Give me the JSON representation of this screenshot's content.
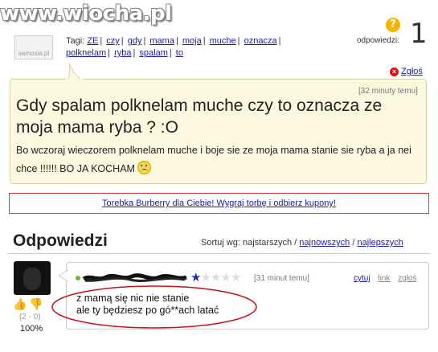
{
  "watermark": "www.wiocha.pl",
  "site_avatar_label": "samosia.pl",
  "tags": {
    "label": "Tagi:",
    "items": [
      "ZE",
      "czy",
      "gdy",
      "mama",
      "moja",
      "muche",
      "oznacza",
      "polknelam",
      "ryba",
      "spalam",
      "to"
    ]
  },
  "answers_label": "odpowiedzi:",
  "answers_count": "1",
  "report_label": "Zgłoś",
  "question": {
    "time": "[32 minuty temu]",
    "title": "Gdy spalam polknelam muche czy to oznacza ze moja mama ryba ? :O",
    "body": "Bo wczoraj wieczorem polknelam muche i boje sie ze moja mama stanie sie ryba a ja nei chce !!!!!! BO JA KOCHAM"
  },
  "ad_text": "Torebka Burberry dla Ciebie! Wygraj torbę i odbierz kupony!",
  "answers_section": {
    "title": "Odpowiedzi",
    "sort_label": "Sortuj wg: najstarszych /",
    "sort_newest": "najnowszych",
    "sort_sep": "/",
    "sort_best": "najlepszych"
  },
  "answer": {
    "rating": 1,
    "rating_max": 5,
    "time": "[31 minut temu]",
    "actions": [
      "cytuj",
      "link",
      "zgłoś"
    ],
    "line1": "z mamą się nic nie stanie",
    "line2": "ale ty będziesz po gó**ach latać",
    "votes": "(2 - 0)",
    "percent": "100%"
  },
  "colors": {
    "bubble_bg": "#fbf8df",
    "ad_border": "#dd3333",
    "link": "#1a1aa6",
    "star_on": "#1d2fa8",
    "ellipse": "#cc1111"
  }
}
